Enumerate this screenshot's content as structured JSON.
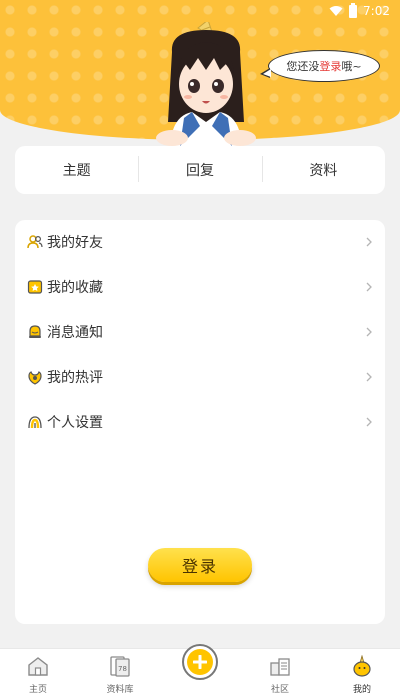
{
  "status_bar": {
    "time": "7:02"
  },
  "header": {
    "bubble": {
      "prefix": "您还没",
      "highlight": "登录",
      "suffix": "哦~"
    }
  },
  "tabs": [
    {
      "label": "主题"
    },
    {
      "label": "回复"
    },
    {
      "label": "资料"
    }
  ],
  "menu": [
    {
      "label": "我的好友",
      "icon": "friends-icon"
    },
    {
      "label": "我的收藏",
      "icon": "favorites-icon"
    },
    {
      "label": "消息通知",
      "icon": "notification-icon"
    },
    {
      "label": "我的热评",
      "icon": "hot-comments-icon"
    },
    {
      "label": "个人设置",
      "icon": "settings-icon"
    }
  ],
  "login_button": {
    "label": "登录"
  },
  "bottom_nav": [
    {
      "label": "主页",
      "icon": "home-icon"
    },
    {
      "label": "资料库",
      "icon": "library-icon"
    },
    {
      "label": "",
      "icon": "plus-icon"
    },
    {
      "label": "社区",
      "icon": "community-icon"
    },
    {
      "label": "我的",
      "icon": "profile-icon",
      "active": true
    }
  ],
  "colors": {
    "accent": "#fdc13a",
    "highlight": "#e53935",
    "button": "#ffd21f"
  }
}
